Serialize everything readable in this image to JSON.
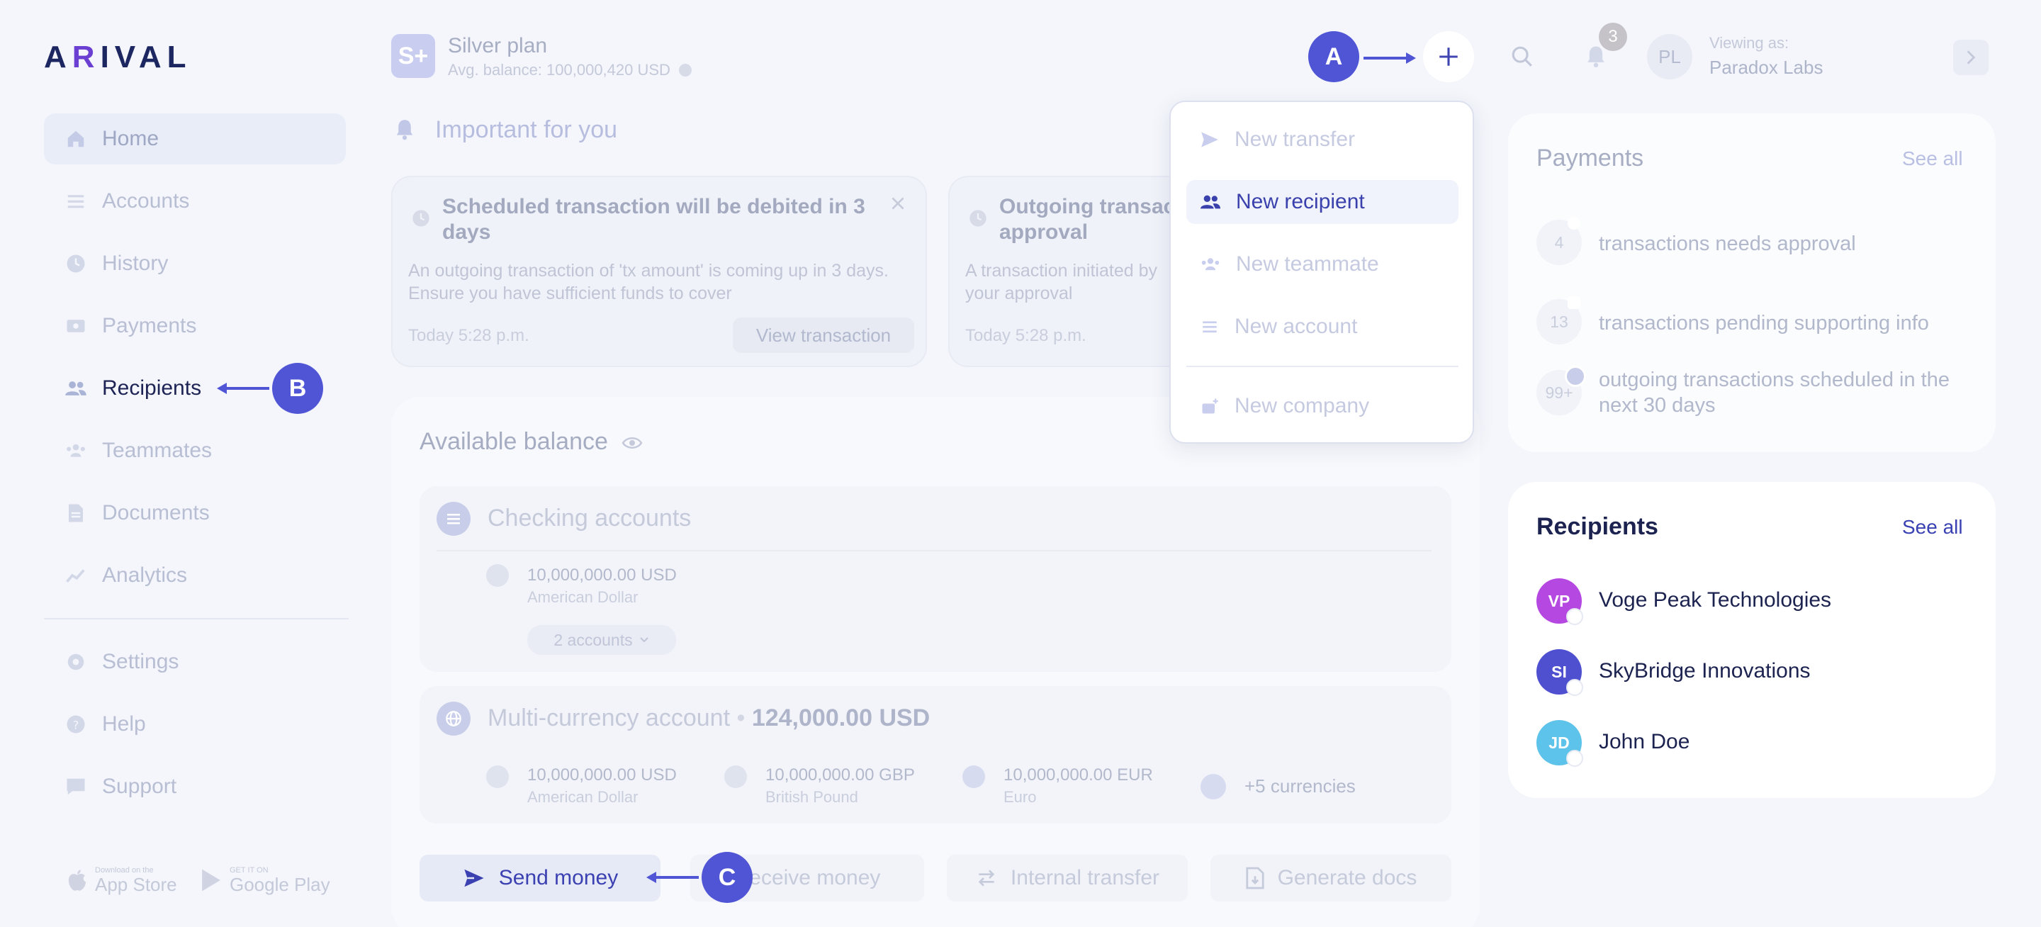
{
  "logo": {
    "before": "A",
    "accent": "R",
    "after": "IVAL"
  },
  "sidebar": {
    "items": [
      {
        "label": "Home",
        "icon": "home-icon"
      },
      {
        "label": "Accounts",
        "icon": "list-icon"
      },
      {
        "label": "History",
        "icon": "clock-icon"
      },
      {
        "label": "Payments",
        "icon": "payments-icon"
      },
      {
        "label": "Recipients",
        "icon": "users-icon"
      },
      {
        "label": "Teammates",
        "icon": "team-icon"
      },
      {
        "label": "Documents",
        "icon": "document-icon"
      },
      {
        "label": "Analytics",
        "icon": "analytics-icon"
      }
    ],
    "bottom": [
      {
        "label": "Settings",
        "icon": "gear-icon"
      },
      {
        "label": "Help",
        "icon": "help-icon"
      },
      {
        "label": "Support",
        "icon": "chat-icon"
      }
    ],
    "app_store": {
      "small": "Download on the",
      "big": "App Store"
    },
    "google_play": {
      "small": "GET IT ON",
      "big": "Google Play"
    }
  },
  "header": {
    "plan_badge": "S+",
    "plan_title": "Silver plan",
    "plan_sub": "Avg. balance: 100,000,420 USD",
    "notif_count": "3",
    "avatar": "PL",
    "viewing_label": "Viewing as:",
    "viewing_name": "Paradox Labs"
  },
  "important": {
    "title": "Important for you",
    "cards": [
      {
        "title": "Scheduled transaction will be debited in 3 days",
        "desc": "An outgoing transaction of 'tx amount' is coming up in 3 days. Ensure you have sufficient funds to cover",
        "time": "Today 5:28 p.m.",
        "button": "View transaction"
      },
      {
        "title": "Outgoing transaction approval",
        "desc": "A transaction initiated by your approval",
        "time": "Today 5:28 p.m."
      }
    ]
  },
  "dropdown": {
    "items": [
      {
        "label": "New transfer",
        "icon": "send-icon"
      },
      {
        "label": "New recipient",
        "icon": "recipient-icon"
      },
      {
        "label": "New teammate",
        "icon": "team-icon"
      },
      {
        "label": "New account",
        "icon": "list-icon"
      },
      {
        "label": "New company",
        "icon": "company-icon"
      }
    ]
  },
  "balance": {
    "title": "Available balance",
    "checking": {
      "title": "Checking accounts",
      "amount": "10,000,000.00 USD",
      "currency": "American Dollar",
      "pill": "2 accounts"
    },
    "multi": {
      "title": "Multi-currency account",
      "total": "124,000.00 USD",
      "currencies": [
        {
          "amount": "10,000,000.00 USD",
          "name": "American Dollar"
        },
        {
          "amount": "10,000,000.00 GBP",
          "name": "British Pound"
        },
        {
          "amount": "10,000,000.00 EUR",
          "name": "Euro"
        }
      ],
      "more": "+5 currencies"
    },
    "actions": [
      "Send money",
      "Receive money",
      "Internal transfer",
      "Generate docs"
    ]
  },
  "payments": {
    "title": "Payments",
    "see_all": "See all",
    "rows": [
      {
        "count": "4",
        "text": "transactions needs approval"
      },
      {
        "count": "13",
        "text": "transactions pending supporting info"
      },
      {
        "count": "99+",
        "text": "outgoing transactions scheduled in the next 30 days"
      }
    ]
  },
  "recipients": {
    "title": "Recipients",
    "see_all": "See all",
    "list": [
      {
        "initials": "VP",
        "name": "Voge Peak Technologies",
        "color": "#b548e0"
      },
      {
        "initials": "SI",
        "name": "SkyBridge Innovations",
        "color": "#4f50cf"
      },
      {
        "initials": "JD",
        "name": "John Doe",
        "color": "#5ec3ea"
      }
    ]
  },
  "annotations": {
    "a": "A",
    "b": "B",
    "c": "C"
  },
  "colors": {
    "accent": "#5055d6",
    "brand_dark": "#1c2660"
  }
}
